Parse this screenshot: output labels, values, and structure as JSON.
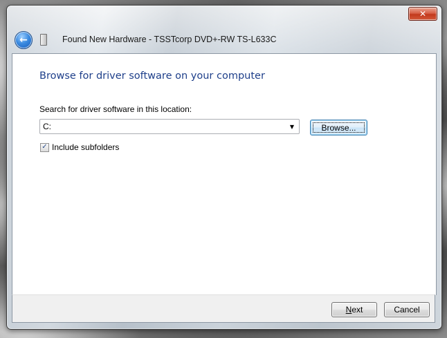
{
  "window": {
    "title": "Found New Hardware - TSSTcorp DVD+-RW TS-L633C",
    "close_glyph": "✕",
    "back_glyph": "←"
  },
  "page": {
    "heading": "Browse for driver software on your computer",
    "location_label": "Search for driver software in this location:",
    "location_value": "C:",
    "dropdown_glyph": "▼",
    "browse_label": "Browse...",
    "include_subfolders_label": "Include subfolders",
    "include_subfolders_checked": true,
    "check_glyph": "✓"
  },
  "footer": {
    "next_first": "N",
    "next_rest": "ext",
    "cancel_label": "Cancel"
  },
  "icons": {
    "back": "back-arrow-icon",
    "hardware": "hardware-device-icon",
    "close": "close-icon",
    "dropdown": "chevron-down-icon"
  },
  "colors": {
    "heading": "#1e3f8a",
    "close_button": "#c2391c",
    "back_button": "#1559b8",
    "focused_button_border": "#3c7fb1"
  }
}
